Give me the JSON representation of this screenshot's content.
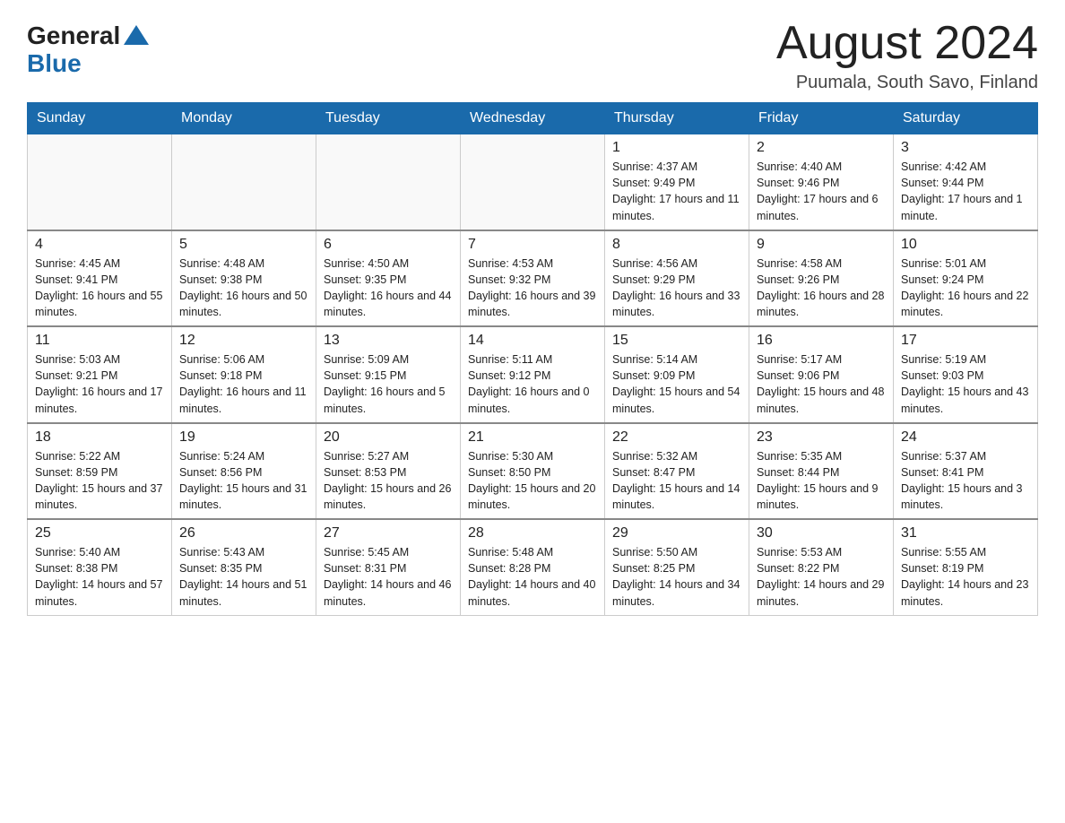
{
  "header": {
    "logo_general": "General",
    "logo_blue": "Blue",
    "title": "August 2024",
    "subtitle": "Puumala, South Savo, Finland"
  },
  "weekdays": [
    "Sunday",
    "Monday",
    "Tuesday",
    "Wednesday",
    "Thursday",
    "Friday",
    "Saturday"
  ],
  "weeks": [
    [
      {
        "day": "",
        "info": ""
      },
      {
        "day": "",
        "info": ""
      },
      {
        "day": "",
        "info": ""
      },
      {
        "day": "",
        "info": ""
      },
      {
        "day": "1",
        "info": "Sunrise: 4:37 AM\nSunset: 9:49 PM\nDaylight: 17 hours and 11 minutes."
      },
      {
        "day": "2",
        "info": "Sunrise: 4:40 AM\nSunset: 9:46 PM\nDaylight: 17 hours and 6 minutes."
      },
      {
        "day": "3",
        "info": "Sunrise: 4:42 AM\nSunset: 9:44 PM\nDaylight: 17 hours and 1 minute."
      }
    ],
    [
      {
        "day": "4",
        "info": "Sunrise: 4:45 AM\nSunset: 9:41 PM\nDaylight: 16 hours and 55 minutes."
      },
      {
        "day": "5",
        "info": "Sunrise: 4:48 AM\nSunset: 9:38 PM\nDaylight: 16 hours and 50 minutes."
      },
      {
        "day": "6",
        "info": "Sunrise: 4:50 AM\nSunset: 9:35 PM\nDaylight: 16 hours and 44 minutes."
      },
      {
        "day": "7",
        "info": "Sunrise: 4:53 AM\nSunset: 9:32 PM\nDaylight: 16 hours and 39 minutes."
      },
      {
        "day": "8",
        "info": "Sunrise: 4:56 AM\nSunset: 9:29 PM\nDaylight: 16 hours and 33 minutes."
      },
      {
        "day": "9",
        "info": "Sunrise: 4:58 AM\nSunset: 9:26 PM\nDaylight: 16 hours and 28 minutes."
      },
      {
        "day": "10",
        "info": "Sunrise: 5:01 AM\nSunset: 9:24 PM\nDaylight: 16 hours and 22 minutes."
      }
    ],
    [
      {
        "day": "11",
        "info": "Sunrise: 5:03 AM\nSunset: 9:21 PM\nDaylight: 16 hours and 17 minutes."
      },
      {
        "day": "12",
        "info": "Sunrise: 5:06 AM\nSunset: 9:18 PM\nDaylight: 16 hours and 11 minutes."
      },
      {
        "day": "13",
        "info": "Sunrise: 5:09 AM\nSunset: 9:15 PM\nDaylight: 16 hours and 5 minutes."
      },
      {
        "day": "14",
        "info": "Sunrise: 5:11 AM\nSunset: 9:12 PM\nDaylight: 16 hours and 0 minutes."
      },
      {
        "day": "15",
        "info": "Sunrise: 5:14 AM\nSunset: 9:09 PM\nDaylight: 15 hours and 54 minutes."
      },
      {
        "day": "16",
        "info": "Sunrise: 5:17 AM\nSunset: 9:06 PM\nDaylight: 15 hours and 48 minutes."
      },
      {
        "day": "17",
        "info": "Sunrise: 5:19 AM\nSunset: 9:03 PM\nDaylight: 15 hours and 43 minutes."
      }
    ],
    [
      {
        "day": "18",
        "info": "Sunrise: 5:22 AM\nSunset: 8:59 PM\nDaylight: 15 hours and 37 minutes."
      },
      {
        "day": "19",
        "info": "Sunrise: 5:24 AM\nSunset: 8:56 PM\nDaylight: 15 hours and 31 minutes."
      },
      {
        "day": "20",
        "info": "Sunrise: 5:27 AM\nSunset: 8:53 PM\nDaylight: 15 hours and 26 minutes."
      },
      {
        "day": "21",
        "info": "Sunrise: 5:30 AM\nSunset: 8:50 PM\nDaylight: 15 hours and 20 minutes."
      },
      {
        "day": "22",
        "info": "Sunrise: 5:32 AM\nSunset: 8:47 PM\nDaylight: 15 hours and 14 minutes."
      },
      {
        "day": "23",
        "info": "Sunrise: 5:35 AM\nSunset: 8:44 PM\nDaylight: 15 hours and 9 minutes."
      },
      {
        "day": "24",
        "info": "Sunrise: 5:37 AM\nSunset: 8:41 PM\nDaylight: 15 hours and 3 minutes."
      }
    ],
    [
      {
        "day": "25",
        "info": "Sunrise: 5:40 AM\nSunset: 8:38 PM\nDaylight: 14 hours and 57 minutes."
      },
      {
        "day": "26",
        "info": "Sunrise: 5:43 AM\nSunset: 8:35 PM\nDaylight: 14 hours and 51 minutes."
      },
      {
        "day": "27",
        "info": "Sunrise: 5:45 AM\nSunset: 8:31 PM\nDaylight: 14 hours and 46 minutes."
      },
      {
        "day": "28",
        "info": "Sunrise: 5:48 AM\nSunset: 8:28 PM\nDaylight: 14 hours and 40 minutes."
      },
      {
        "day": "29",
        "info": "Sunrise: 5:50 AM\nSunset: 8:25 PM\nDaylight: 14 hours and 34 minutes."
      },
      {
        "day": "30",
        "info": "Sunrise: 5:53 AM\nSunset: 8:22 PM\nDaylight: 14 hours and 29 minutes."
      },
      {
        "day": "31",
        "info": "Sunrise: 5:55 AM\nSunset: 8:19 PM\nDaylight: 14 hours and 23 minutes."
      }
    ]
  ]
}
